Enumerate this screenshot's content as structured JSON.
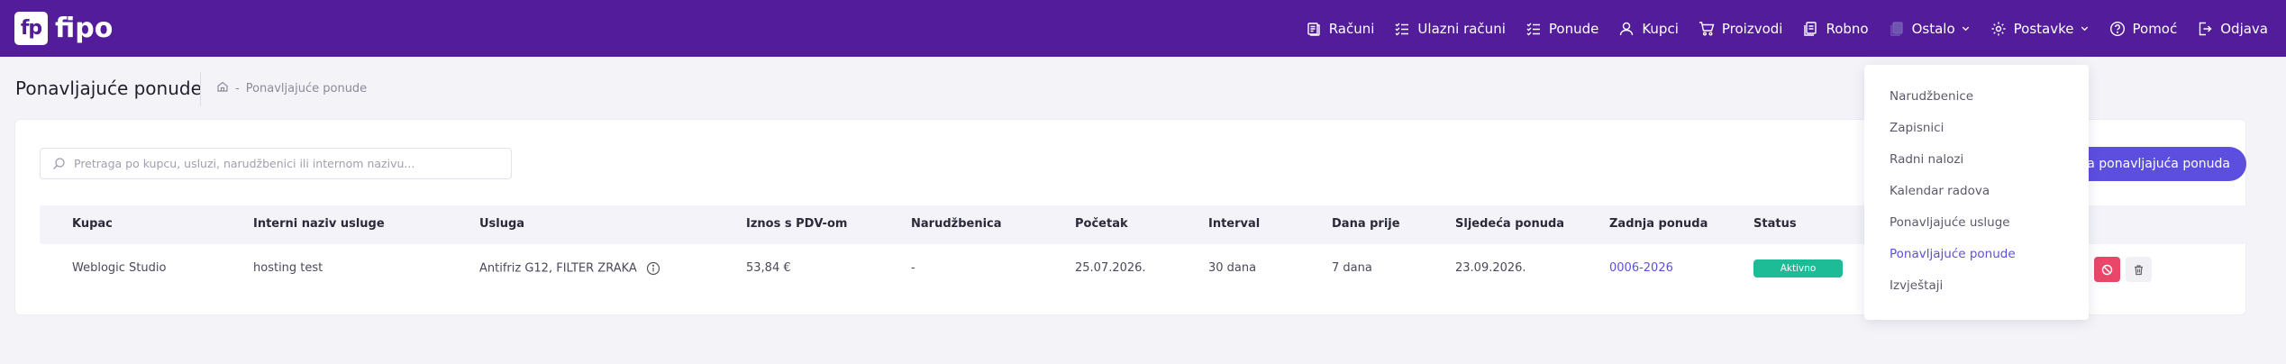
{
  "app": {
    "logo_mark": "fp",
    "logo_text": "fipo"
  },
  "nav": [
    {
      "label": "Računi",
      "icon": "receipt-icon"
    },
    {
      "label": "Ulazni računi",
      "icon": "list-check-icon"
    },
    {
      "label": "Ponude",
      "icon": "list-check-icon"
    },
    {
      "label": "Kupci",
      "icon": "user-icon"
    },
    {
      "label": "Proizvodi",
      "icon": "cart-icon"
    },
    {
      "label": "Robno",
      "icon": "documents-icon"
    },
    {
      "label": "Ostalo",
      "icon": "documents-icon",
      "dropdown": true
    },
    {
      "label": "Postavke",
      "icon": "gear-icon",
      "dropdown": true
    },
    {
      "label": "Pomoć",
      "icon": "help-icon"
    },
    {
      "label": "Odjava",
      "icon": "logout-icon"
    }
  ],
  "page": {
    "title": "Ponavljajuće ponude",
    "breadcrumb_sep": "-",
    "breadcrumb_current": "Ponavljajuće ponude"
  },
  "search": {
    "placeholder": "Pretraga po kupcu, usluzi, narudžbenici ili internom nazivu..."
  },
  "new_button": {
    "label": "Nova ponavljajuća ponuda",
    "visible_label": "va ponavljajuća ponuda"
  },
  "table": {
    "headers": [
      "Kupac",
      "Interni naziv usluge",
      "Usluga",
      "Iznos s PDV-om",
      "Narudžbenica",
      "Početak",
      "Interval",
      "Dana prije",
      "Sljedeća ponuda",
      "Zadnja ponuda",
      "Status"
    ],
    "rows": [
      {
        "kupac": "Weblogic Studio",
        "interni_naziv": "hosting test",
        "usluga": "Antifriz G12, FILTER ZRAKA",
        "iznos": "53,84 €",
        "narudzbenica": "-",
        "pocetak": "25.07.2026.",
        "interval": "30 dana",
        "dana_prije": "7 dana",
        "sljedeca": "23.09.2026.",
        "zadnja": "0006-2026",
        "status": "Aktivno"
      }
    ]
  },
  "dropdown": {
    "items": [
      {
        "label": "Narudžbenice",
        "active": false
      },
      {
        "label": "Zapisnici",
        "active": false
      },
      {
        "label": "Radni nalozi",
        "active": false
      },
      {
        "label": "Kalendar radova",
        "active": false
      },
      {
        "label": "Ponavljajuće usluge",
        "active": false
      },
      {
        "label": "Ponavljajuće ponude",
        "active": true
      },
      {
        "label": "Izvještaji",
        "active": false
      }
    ]
  },
  "colors": {
    "topbar": "#521c9a",
    "accent": "#5c4fe0",
    "status_active": "#1dbb96",
    "danger": "#e8476a"
  }
}
